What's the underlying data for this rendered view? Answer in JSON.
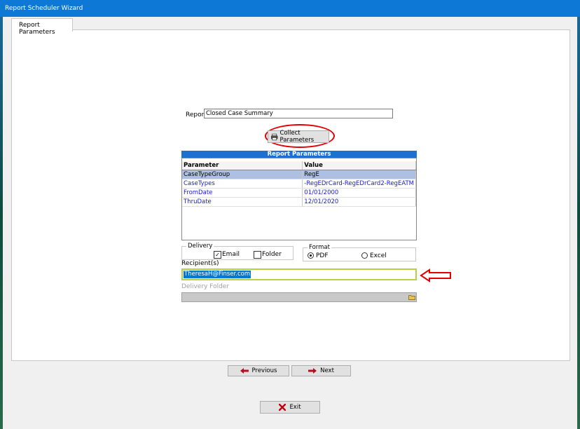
{
  "window": {
    "title": "Report Scheduler Wizard"
  },
  "tabs": [
    {
      "label": "Report Parameters"
    }
  ],
  "report": {
    "label": "Report",
    "value": "Closed Case Summary"
  },
  "collect_button": {
    "label": "Collect Parameters",
    "icon": "printer-icon"
  },
  "parameters_grid": {
    "header": "Report Parameters",
    "columns": [
      "Parameter",
      "Value"
    ],
    "rows": [
      {
        "parameter": "CaseTypeGroup",
        "value": "RegE",
        "selected": true
      },
      {
        "parameter": "CaseTypes",
        "value": "-RegEDrCard-RegEDrCard2-RegEATM"
      },
      {
        "parameter": "FromDate",
        "value": "01/01/2000"
      },
      {
        "parameter": "ThruDate",
        "value": "12/01/2020"
      }
    ]
  },
  "delivery": {
    "label": "Delivery",
    "email": {
      "label": "Email",
      "checked": true
    },
    "folder": {
      "label": "Folder",
      "checked": false
    }
  },
  "format": {
    "label": "Format",
    "pdf": {
      "label": "PDF",
      "selected": true
    },
    "excel": {
      "label": "Excel",
      "selected": false
    }
  },
  "recipients": {
    "label": "Recipient(s)",
    "value": "TheresaH@Finser.com"
  },
  "delivery_folder": {
    "label": "Delivery Folder",
    "value": ""
  },
  "navigation": {
    "previous_label": "Previous",
    "next_label": "Next"
  },
  "exit": {
    "label": "Exit"
  },
  "colors": {
    "title_bar": "#0e78d7",
    "grid_header": "#1e70d0",
    "highlight": "#e00000",
    "link_text": "#1a1acc"
  }
}
